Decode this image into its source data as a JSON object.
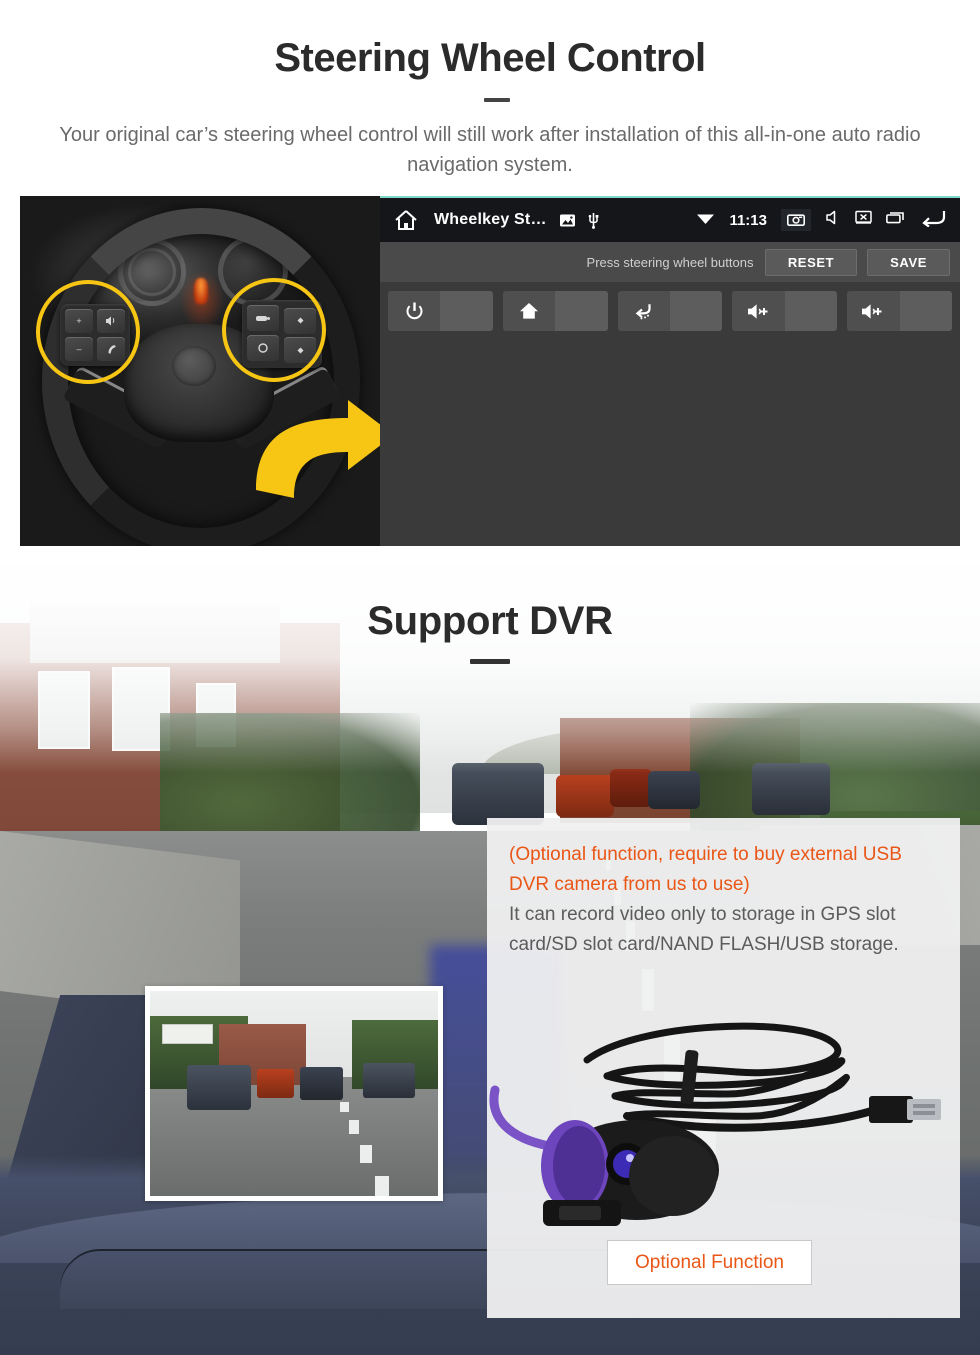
{
  "sections": {
    "steering": {
      "title": "Steering Wheel Control",
      "subtitle": "Your original car’s steering wheel control will still work after installation of this all-in-one auto radio navigation system.",
      "photo_alt": "car-steering-wheel-with-control-buttons",
      "headunit": {
        "status": {
          "app_title": "Wheelkey St…",
          "time": "11:13",
          "icons": [
            "home-icon",
            "gallery-icon",
            "usb-icon",
            "wifi-icon",
            "screenshot-icon",
            "mute-icon",
            "screen-off-icon",
            "recents-icon",
            "back-icon"
          ]
        },
        "hint": "Press steering wheel buttons",
        "reset_label": "RESET",
        "save_label": "SAVE",
        "keys": [
          {
            "icon": "power-icon",
            "value": ""
          },
          {
            "icon": "home-icon",
            "value": ""
          },
          {
            "icon": "back-icon",
            "value": ""
          },
          {
            "icon": "volume-up-icon",
            "value": ""
          },
          {
            "icon": "volume-up-icon",
            "value": ""
          }
        ]
      }
    },
    "dvr": {
      "title": "Support DVR",
      "note_highlight": "(Optional function, require to buy external USB DVR camera from us to use)",
      "note_body": "It can record video only to storage in GPS slot card/SD slot card/NAND FLASH/USB storage.",
      "button_label": "Optional Function",
      "camera_alt": "usb-dvr-camera-with-cable",
      "inset_alt": "dashcam-recorded-street-view"
    }
  },
  "colors": {
    "accent_orange": "#ea5616",
    "highlight_yellow": "#f7c614",
    "heading_dark": "#2b2b2b",
    "body_gray": "#6a6a6a",
    "headunit_bg": "#3a3a3a",
    "statusbar_bg": "#141619"
  }
}
